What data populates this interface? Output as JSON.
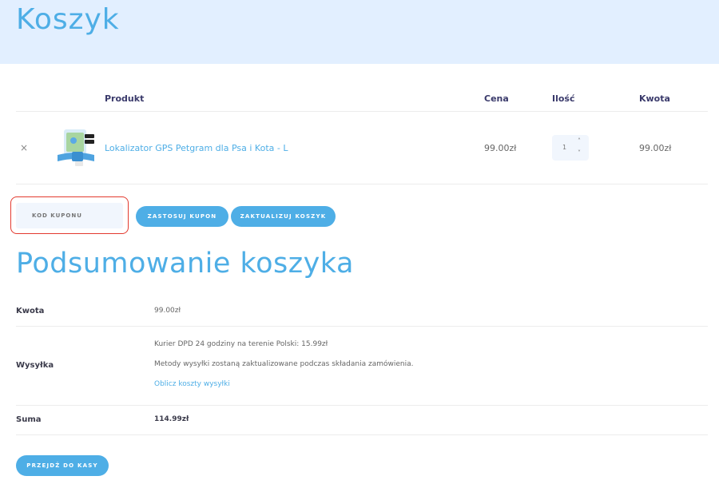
{
  "page": {
    "title": "Koszyk"
  },
  "cart": {
    "headers": {
      "product": "Produkt",
      "price": "Cena",
      "qty": "Ilość",
      "subtotal": "Kwota"
    },
    "items": [
      {
        "remove_icon": "×",
        "name": "Lokalizator GPS Petgram dla Psa i Kota - L",
        "price": "99.00zł",
        "qty": "1",
        "subtotal": "99.00zł"
      }
    ],
    "qty_up": "˄",
    "qty_down": "˅"
  },
  "coupon": {
    "placeholder": "KOD KUPONU",
    "apply_label": "ZASTOSUJ KUPON",
    "update_label": "ZAKTUALIZUJ KOSZYK"
  },
  "summary": {
    "title": "Podsumowanie koszyka",
    "subtotal_label": "Kwota",
    "subtotal_value": "99.00zł",
    "shipping_label": "Wysyłka",
    "shipping_option": "Kurier DPD 24 godziny na terenie Polski: 15.99zł",
    "shipping_note": "Metody wysyłki zostaną zaktualizowane podczas składania zamówienia.",
    "shipping_calc_link": "Oblicz koszty wysyłki",
    "total_label": "Suma",
    "total_value": "114.99zł",
    "checkout_label": "PRZEJDŹ DO KASY"
  },
  "colors": {
    "accent": "#4eaee6",
    "hero_bg": "#e2efff",
    "highlight": "#e33a2f"
  }
}
